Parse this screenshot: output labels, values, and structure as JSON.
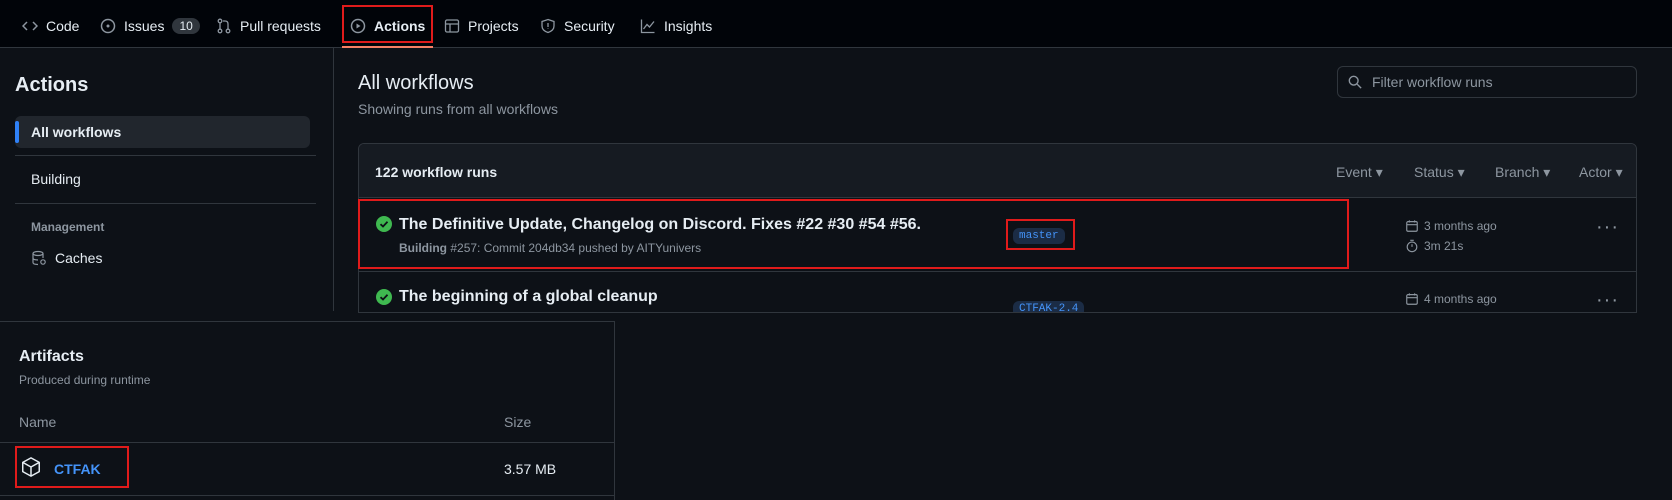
{
  "nav": {
    "code": "Code",
    "issues": "Issues",
    "issues_count": "10",
    "pull_requests": "Pull requests",
    "actions": "Actions",
    "projects": "Projects",
    "security": "Security",
    "insights": "Insights"
  },
  "sidebar": {
    "title": "Actions",
    "all_workflows": "All workflows",
    "building": "Building",
    "management_heading": "Management",
    "caches": "Caches"
  },
  "main": {
    "title": "All workflows",
    "subtitle": "Showing runs from all workflows",
    "filter_placeholder": "Filter workflow runs",
    "runs_count": "122 workflow runs",
    "filters": [
      "Event",
      "Status",
      "Branch",
      "Actor"
    ]
  },
  "runs": [
    {
      "title": "The Definitive Update, Changelog on Discord. Fixes #22 #30 #54 #56.",
      "workflow": "Building",
      "meta": "#257: Commit 204db34 pushed by AITYunivers",
      "branch": "master",
      "date": "3 months ago",
      "duration": "3m 21s"
    },
    {
      "title": "The beginning of a global cleanup",
      "branch": "CTFAK-2.4",
      "date": "4 months ago"
    }
  ],
  "artifacts": {
    "title": "Artifacts",
    "subtitle": "Produced during runtime",
    "col_name": "Name",
    "col_size": "Size",
    "items": [
      {
        "name": "CTFAK",
        "size": "3.57 MB"
      }
    ]
  },
  "colors": {
    "background": "#0d1117",
    "accent_blue": "#4493f8",
    "success_green": "#3fb950",
    "highlight_red": "#e01b1b",
    "tab_underline": "#f78166"
  }
}
